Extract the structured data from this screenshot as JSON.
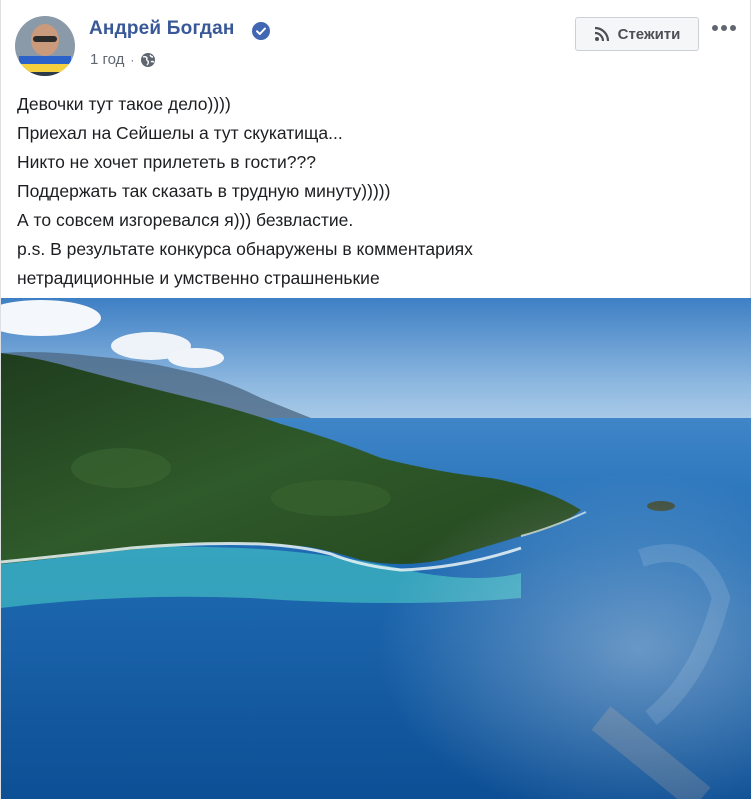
{
  "post": {
    "author": "Андрей Богдан",
    "verified": true,
    "time": "1 год",
    "privacy_icon": "globe-icon",
    "follow_button": "Стежити",
    "more_button": "•••",
    "text_lines": [
      "Девочки тут такое дело))))",
      "Приехал на Сейшелы а тут скукатища...",
      "Никто не хочет прилететь в гости???",
      "Поддержать так сказать в трудную минуту)))))",
      "А то совсем изгоревался я))) безвластие.",
      "p.s. В результате конкурса обнаружены в комментариях",
      "нетрадиционные и умственно страшненькие"
    ]
  },
  "colors": {
    "author": "#385898",
    "verified": "#4267b2",
    "text": "#1c1e21",
    "meta": "#606770"
  }
}
